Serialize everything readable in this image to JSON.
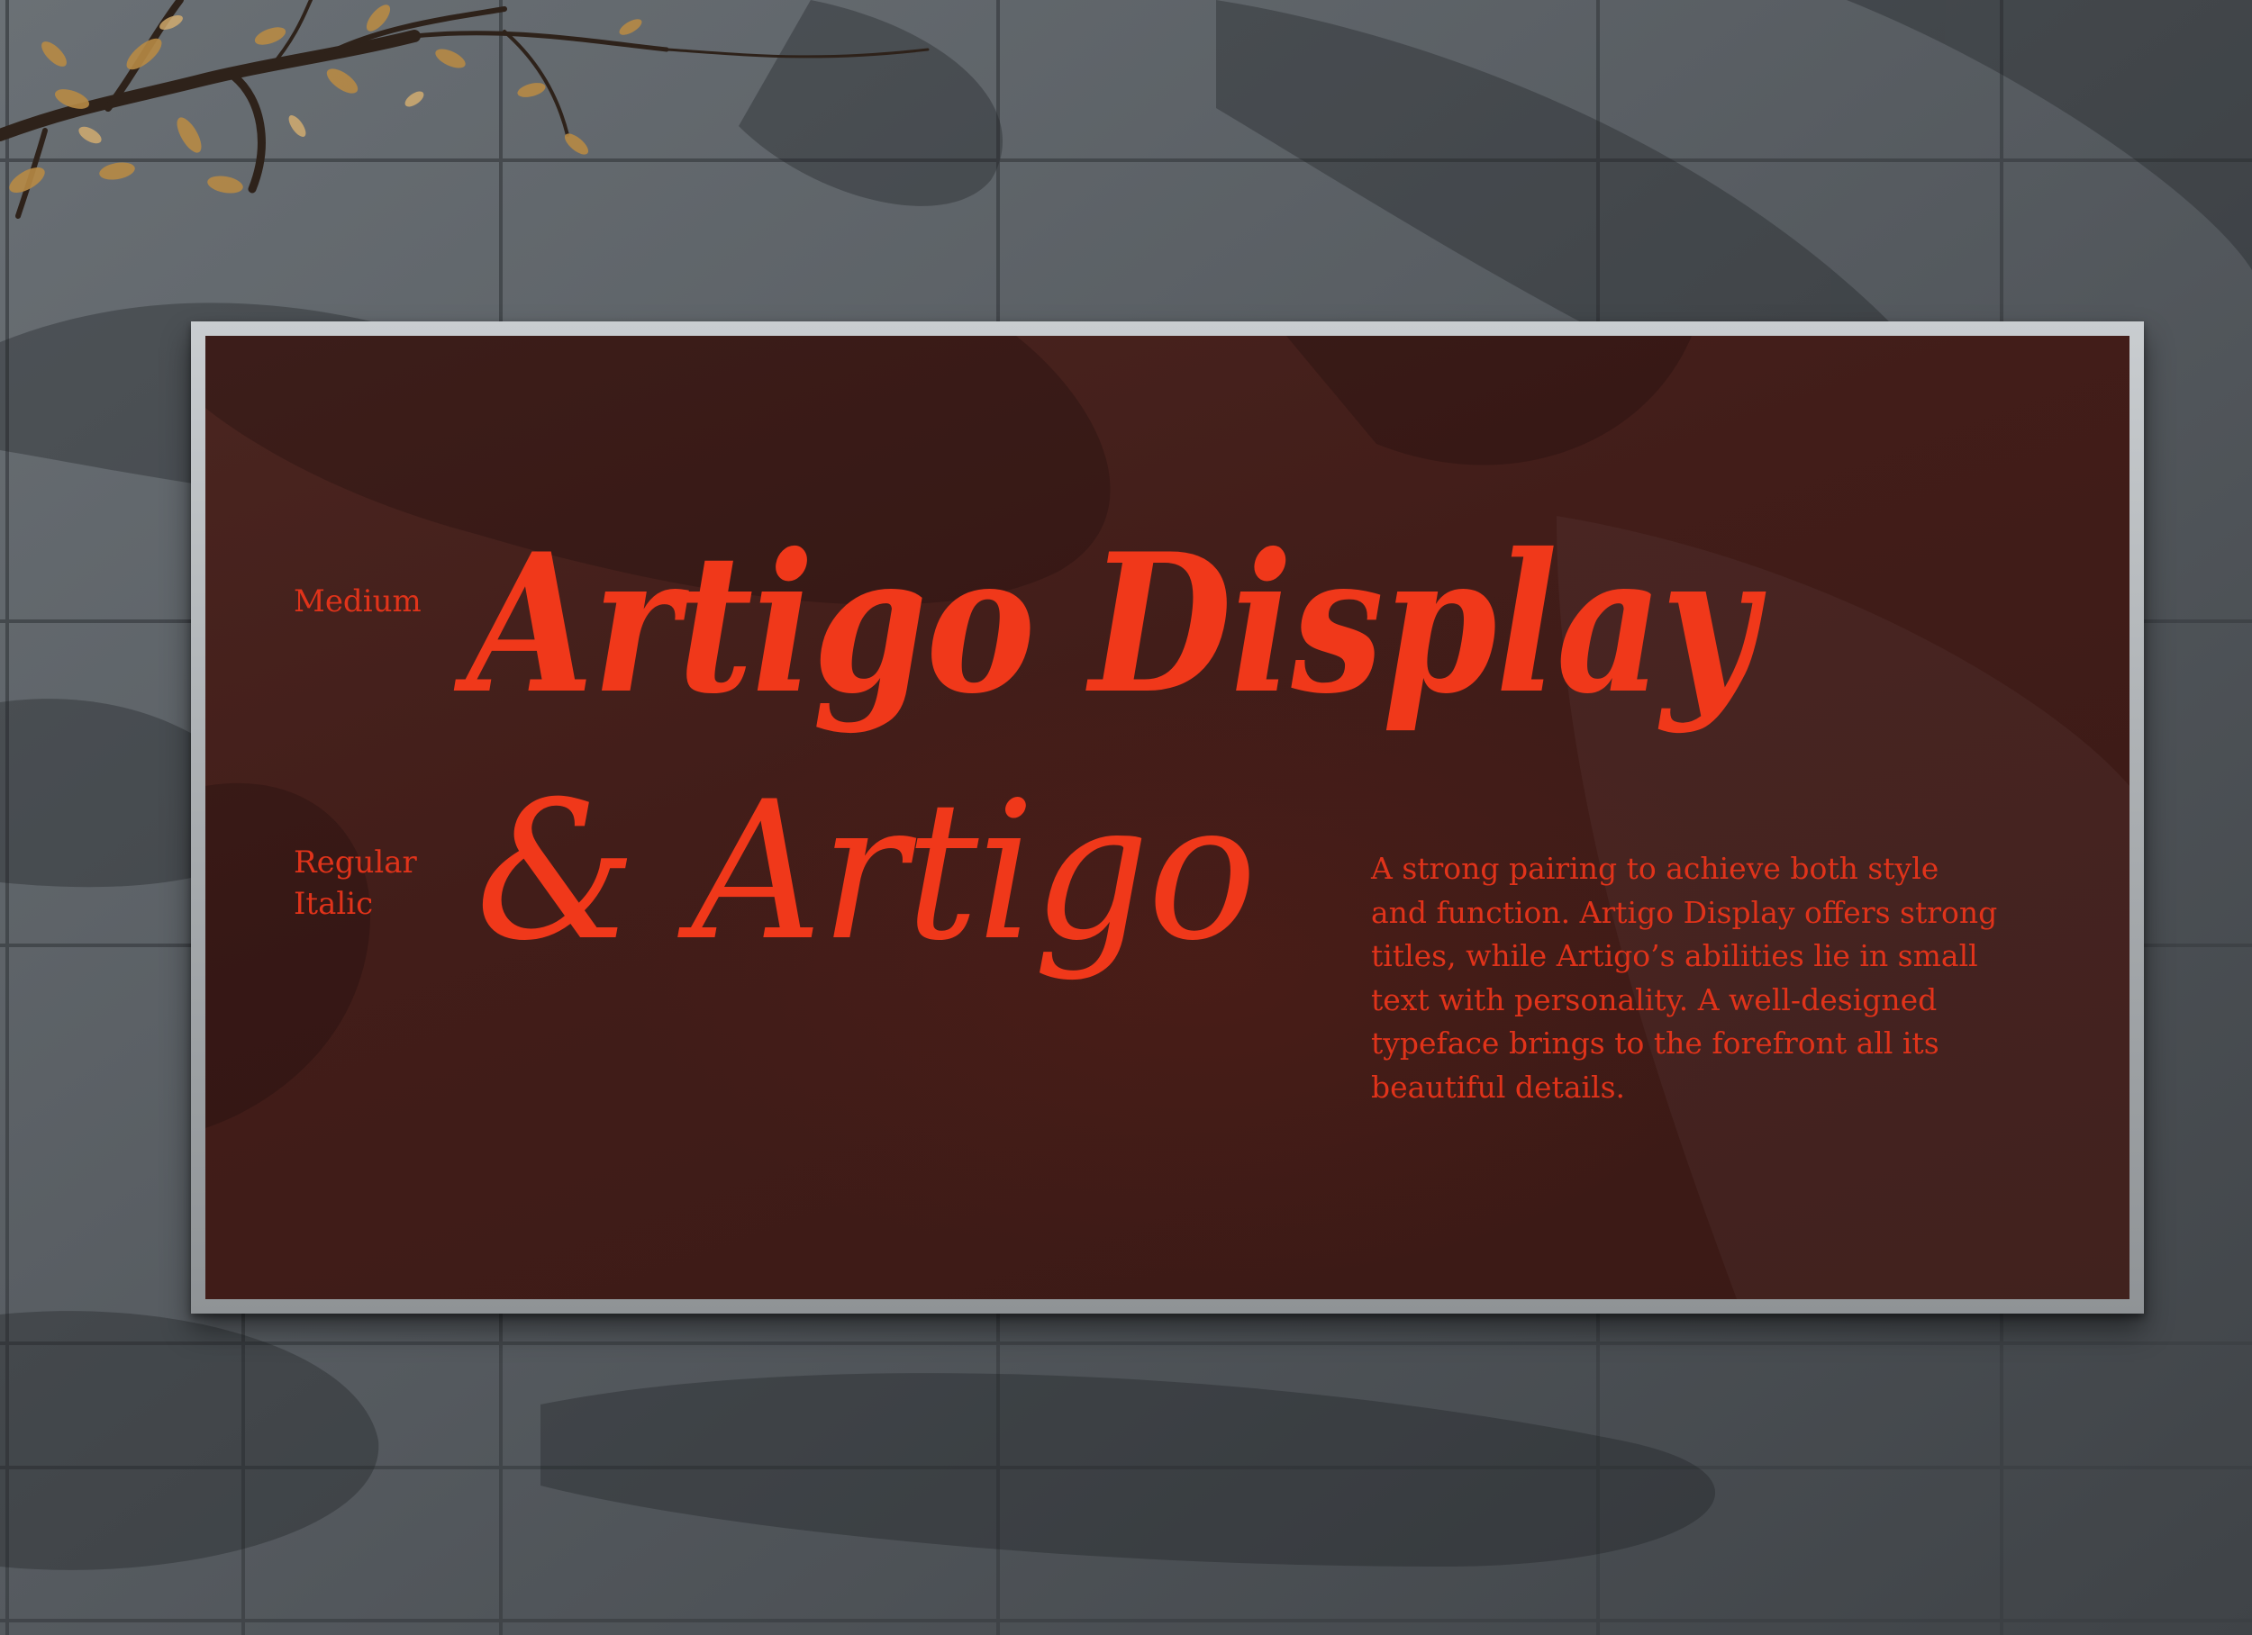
{
  "scene": {
    "description_colors": {
      "wall": "#5a6065",
      "billboard_panel": "#431e19",
      "billboard_frame": "#b5b9bc",
      "text_accent": "#f0381a"
    }
  },
  "billboard": {
    "label_medium": "Medium",
    "label_regular_italic": "Regular\nItalic",
    "headline_line1": "Artigo Display",
    "headline_line2": "& Artigo",
    "body_text": "A strong pairing to achieve both style\nand function. Artigo Display offers strong\ntitles, while Artigo’s abilities lie in small\ntext with personality. A well-designed\ntypeface brings to the forefront all its\nbeautiful details."
  },
  "icons": {
    "branch": "tree-branch-icon"
  }
}
